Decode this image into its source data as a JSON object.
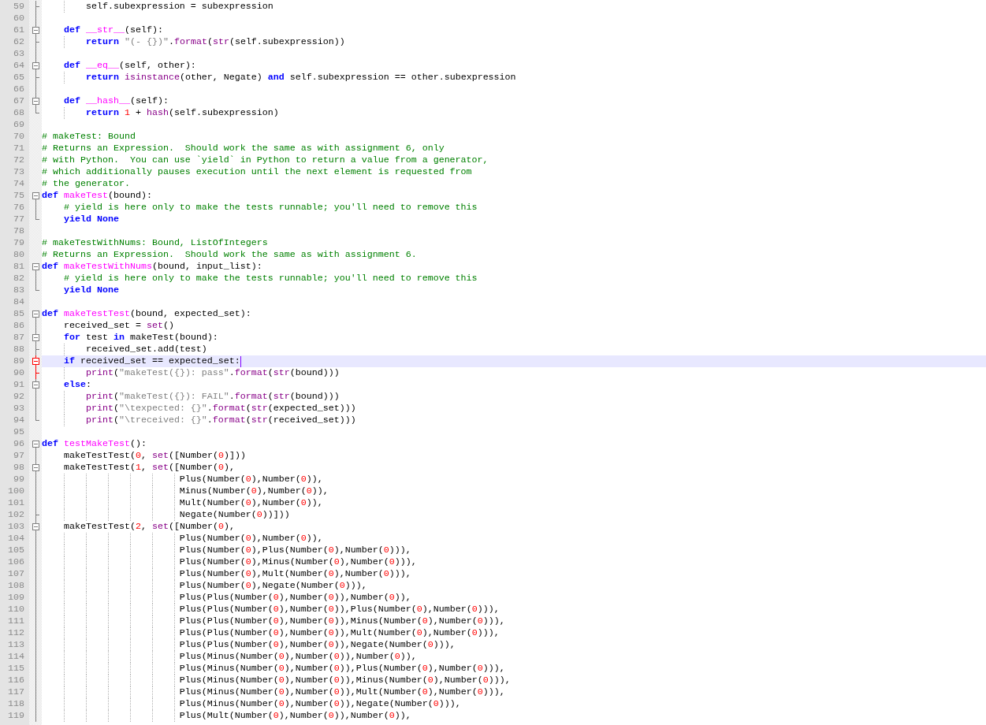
{
  "editor": {
    "lines": [
      {
        "number": "59",
        "current": false,
        "fold": {
          "kind": "tick",
          "active": false
        },
        "tokens": [
          {
            "kind": "txt",
            "text": "        self.subexpression = subexpression"
          }
        ]
      },
      {
        "number": "60",
        "current": false,
        "fold": {
          "kind": "line",
          "active": false
        }
      },
      {
        "number": "61",
        "current": false,
        "fold": {
          "kind": "start",
          "active": false
        },
        "tokens": [
          {
            "kind": "kw",
            "text": "    def"
          },
          {
            "kind": "fn",
            "text": " __str__"
          },
          {
            "kind": "txt",
            "text": "(self):"
          }
        ]
      },
      {
        "number": "62",
        "current": false,
        "fold": {
          "kind": "tick",
          "active": false
        },
        "tokens": [
          {
            "kind": "kw",
            "text": "        return"
          },
          {
            "kind": "str",
            "text": " \"(- {})\""
          },
          {
            "kind": "txt",
            "text": "."
          },
          {
            "kind": "bi",
            "text": "format"
          },
          {
            "kind": "txt",
            "text": "("
          },
          {
            "kind": "bi",
            "text": "str"
          },
          {
            "kind": "txt",
            "text": "(self.subexpression))"
          }
        ]
      },
      {
        "number": "63",
        "current": false,
        "fold": {
          "kind": "line",
          "active": false
        }
      },
      {
        "number": "64",
        "current": false,
        "fold": {
          "kind": "start",
          "active": false
        },
        "tokens": [
          {
            "kind": "kw",
            "text": "    def"
          },
          {
            "kind": "fn",
            "text": " __eq__"
          },
          {
            "kind": "txt",
            "text": "(self, other):"
          }
        ]
      },
      {
        "number": "65",
        "current": false,
        "fold": {
          "kind": "tick",
          "active": false
        },
        "tokens": [
          {
            "kind": "kw",
            "text": "        return"
          },
          {
            "kind": "bi",
            "text": " isinstance"
          },
          {
            "kind": "txt",
            "text": "(other, Negate) "
          },
          {
            "kind": "kw",
            "text": "and"
          },
          {
            "kind": "txt",
            "text": " self.subexpression == other.subexpression"
          }
        ]
      },
      {
        "number": "66",
        "current": false,
        "fold": {
          "kind": "line",
          "active": false
        }
      },
      {
        "number": "67",
        "current": false,
        "fold": {
          "kind": "start",
          "active": false
        },
        "tokens": [
          {
            "kind": "kw",
            "text": "    def"
          },
          {
            "kind": "fn",
            "text": " __hash__"
          },
          {
            "kind": "txt",
            "text": "(self):"
          }
        ]
      },
      {
        "number": "68",
        "current": false,
        "fold": {
          "kind": "end",
          "active": false
        },
        "tokens": [
          {
            "kind": "kw",
            "text": "        return"
          },
          {
            "kind": "txt",
            "text": " 1 + "
          },
          {
            "kind": "bi",
            "text": "hash"
          },
          {
            "kind": "txt",
            "text": "(self.subexpression)"
          }
        ]
      },
      {
        "number": "69",
        "current": false
      },
      {
        "number": "70",
        "current": false,
        "tokens": [
          {
            "kind": "com",
            "text": "# makeTest: Bound"
          }
        ]
      },
      {
        "number": "71",
        "current": false,
        "tokens": [
          {
            "kind": "com",
            "text": "# Returns an Expression.  Should work the same as with assignment 6, only"
          }
        ]
      },
      {
        "number": "72",
        "current": false,
        "tokens": [
          {
            "kind": "com",
            "text": "# with Python.  You can use `yield` in Python to return a value from a generator,"
          }
        ]
      },
      {
        "number": "73",
        "current": false,
        "tokens": [
          {
            "kind": "com",
            "text": "# which additionally pauses execution until the next element is requested from"
          }
        ]
      },
      {
        "number": "74",
        "current": false,
        "tokens": [
          {
            "kind": "com",
            "text": "# the generator."
          }
        ]
      },
      {
        "number": "75",
        "current": false,
        "fold": {
          "kind": "start",
          "active": false
        },
        "tokens": [
          {
            "kind": "kw",
            "text": "def"
          },
          {
            "kind": "fn",
            "text": " makeTest"
          },
          {
            "kind": "txt",
            "text": "(bound):"
          }
        ]
      },
      {
        "number": "76",
        "current": false,
        "fold": {
          "kind": "line",
          "active": false
        },
        "tokens": [
          {
            "kind": "com",
            "text": "    # yield is here only to make the tests runnable; you'll need to remove this"
          }
        ]
      },
      {
        "number": "77",
        "current": false,
        "fold": {
          "kind": "end",
          "active": false
        },
        "tokens": [
          {
            "kind": "kw",
            "text": "    yield None"
          }
        ]
      },
      {
        "number": "78",
        "current": false
      },
      {
        "number": "79",
        "current": false,
        "tokens": [
          {
            "kind": "com",
            "text": "# makeTestWithNums: Bound, ListOfIntegers"
          }
        ]
      },
      {
        "number": "80",
        "current": false,
        "tokens": [
          {
            "kind": "com",
            "text": "# Returns an Expression.  Should work the same as with assignment 6."
          }
        ]
      },
      {
        "number": "81",
        "current": false,
        "fold": {
          "kind": "start",
          "active": false
        },
        "tokens": [
          {
            "kind": "kw",
            "text": "def"
          },
          {
            "kind": "fn",
            "text": " makeTestWithNums"
          },
          {
            "kind": "txt",
            "text": "(bound, input_list):"
          }
        ]
      },
      {
        "number": "82",
        "current": false,
        "fold": {
          "kind": "line",
          "active": false
        },
        "tokens": [
          {
            "kind": "com",
            "text": "    # yield is here only to make the tests runnable; you'll need to remove this"
          }
        ]
      },
      {
        "number": "83",
        "current": false,
        "fold": {
          "kind": "end",
          "active": false
        },
        "tokens": [
          {
            "kind": "kw",
            "text": "    yield None"
          }
        ]
      },
      {
        "number": "84",
        "current": false
      },
      {
        "number": "85",
        "current": false,
        "fold": {
          "kind": "start",
          "active": false
        },
        "tokens": [
          {
            "kind": "kw",
            "text": "def"
          },
          {
            "kind": "fn",
            "text": " makeTestTest"
          },
          {
            "kind": "txt",
            "text": "(bound, expected_set):"
          }
        ]
      },
      {
        "number": "86",
        "current": false,
        "fold": {
          "kind": "line",
          "active": false
        },
        "tokens": [
          {
            "kind": "txt",
            "text": "    received_set = "
          },
          {
            "kind": "bi",
            "text": "set"
          },
          {
            "kind": "txt",
            "text": "()"
          }
        ]
      },
      {
        "number": "87",
        "current": false,
        "fold": {
          "kind": "start",
          "active": false
        },
        "tokens": [
          {
            "kind": "kw",
            "text": "    for"
          },
          {
            "kind": "txt",
            "text": " test "
          },
          {
            "kind": "kw",
            "text": "in"
          },
          {
            "kind": "txt",
            "text": " makeTest(bound):"
          }
        ]
      },
      {
        "number": "88",
        "current": false,
        "fold": {
          "kind": "tick",
          "active": false
        },
        "tokens": [
          {
            "kind": "txt",
            "text": "        received_set.add(test)"
          }
        ]
      },
      {
        "number": "89",
        "current": true,
        "fold": {
          "kind": "start",
          "active": true
        },
        "tokens": [
          {
            "kind": "kw",
            "text": "    if"
          },
          {
            "kind": "txt",
            "text": " received_set == expected_set:"
          }
        ]
      },
      {
        "number": "90",
        "current": false,
        "fold": {
          "kind": "tick",
          "active": true
        },
        "tokens": [
          {
            "kind": "bi",
            "text": "        print"
          },
          {
            "kind": "txt",
            "text": "("
          },
          {
            "kind": "str",
            "text": "\"makeTest({}): pass\""
          },
          {
            "kind": "txt",
            "text": "."
          },
          {
            "kind": "bi",
            "text": "format"
          },
          {
            "kind": "txt",
            "text": "("
          },
          {
            "kind": "bi",
            "text": "str"
          },
          {
            "kind": "txt",
            "text": "(bound)))"
          }
        ]
      },
      {
        "number": "91",
        "current": false,
        "fold": {
          "kind": "start",
          "active": false
        },
        "tokens": [
          {
            "kind": "kw",
            "text": "    else"
          },
          {
            "kind": "txt",
            "text": ":"
          }
        ]
      },
      {
        "number": "92",
        "current": false,
        "fold": {
          "kind": "line",
          "active": false
        },
        "tokens": [
          {
            "kind": "bi",
            "text": "        print"
          },
          {
            "kind": "txt",
            "text": "("
          },
          {
            "kind": "str",
            "text": "\"makeTest({}): FAIL\""
          },
          {
            "kind": "txt",
            "text": "."
          },
          {
            "kind": "bi",
            "text": "format"
          },
          {
            "kind": "txt",
            "text": "("
          },
          {
            "kind": "bi",
            "text": "str"
          },
          {
            "kind": "txt",
            "text": "(bound)))"
          }
        ]
      },
      {
        "number": "93",
        "current": false,
        "fold": {
          "kind": "line",
          "active": false
        },
        "tokens": [
          {
            "kind": "bi",
            "text": "        print"
          },
          {
            "kind": "txt",
            "text": "("
          },
          {
            "kind": "str",
            "text": "\"\\texpected: {}\""
          },
          {
            "kind": "txt",
            "text": "."
          },
          {
            "kind": "bi",
            "text": "format"
          },
          {
            "kind": "txt",
            "text": "("
          },
          {
            "kind": "bi",
            "text": "str"
          },
          {
            "kind": "txt",
            "text": "(expected_set)))"
          }
        ]
      },
      {
        "number": "94",
        "current": false,
        "fold": {
          "kind": "end",
          "active": false
        },
        "tokens": [
          {
            "kind": "bi",
            "text": "        print"
          },
          {
            "kind": "txt",
            "text": "("
          },
          {
            "kind": "str",
            "text": "\"\\treceived: {}\""
          },
          {
            "kind": "txt",
            "text": "."
          },
          {
            "kind": "bi",
            "text": "format"
          },
          {
            "kind": "txt",
            "text": "("
          },
          {
            "kind": "bi",
            "text": "str"
          },
          {
            "kind": "txt",
            "text": "(received_set)))"
          }
        ]
      },
      {
        "number": "95",
        "current": false
      },
      {
        "number": "96",
        "current": false,
        "fold": {
          "kind": "start",
          "active": false
        },
        "tokens": [
          {
            "kind": "kw",
            "text": "def"
          },
          {
            "kind": "fn",
            "text": " testMakeTest"
          },
          {
            "kind": "txt",
            "text": "():"
          }
        ]
      },
      {
        "number": "97",
        "current": false,
        "fold": {
          "kind": "line",
          "active": false
        },
        "tokens": [
          {
            "kind": "txt",
            "text": "    makeTestTest(0, "
          },
          {
            "kind": "bi",
            "text": "set"
          },
          {
            "kind": "txt",
            "text": "([Number(0)]))"
          }
        ]
      },
      {
        "number": "98",
        "current": false,
        "fold": {
          "kind": "start",
          "active": false
        },
        "tokens": [
          {
            "kind": "txt",
            "text": "    makeTestTest(1, "
          },
          {
            "kind": "bi",
            "text": "set"
          },
          {
            "kind": "txt",
            "text": "([Number(0),"
          }
        ]
      },
      {
        "number": "99",
        "current": false,
        "fold": {
          "kind": "line",
          "active": false
        },
        "tokens": [
          {
            "kind": "txt",
            "text": "                         Plus(Number(0),Number(0)),"
          }
        ]
      },
      {
        "number": "100",
        "current": false,
        "fold": {
          "kind": "line",
          "active": false
        },
        "tokens": [
          {
            "kind": "txt",
            "text": "                         Minus(Number(0),Number(0)),"
          }
        ]
      },
      {
        "number": "101",
        "current": false,
        "fold": {
          "kind": "line",
          "active": false
        },
        "tokens": [
          {
            "kind": "txt",
            "text": "                         Mult(Number(0),Number(0)),"
          }
        ]
      },
      {
        "number": "102",
        "current": false,
        "fold": {
          "kind": "tick",
          "active": false
        },
        "tokens": [
          {
            "kind": "txt",
            "text": "                         Negate(Number(0))]))"
          }
        ]
      },
      {
        "number": "103",
        "current": false,
        "fold": {
          "kind": "start",
          "active": false
        },
        "tokens": [
          {
            "kind": "txt",
            "text": "    makeTestTest(2, "
          },
          {
            "kind": "bi",
            "text": "set"
          },
          {
            "kind": "txt",
            "text": "([Number(0),"
          }
        ]
      },
      {
        "number": "104",
        "current": false,
        "fold": {
          "kind": "line",
          "active": false
        },
        "tokens": [
          {
            "kind": "txt",
            "text": "                         Plus(Number(0),Number(0)),"
          }
        ]
      },
      {
        "number": "105",
        "current": false,
        "fold": {
          "kind": "line",
          "active": false
        },
        "tokens": [
          {
            "kind": "txt",
            "text": "                         Plus(Number(0),Plus(Number(0),Number(0))),"
          }
        ]
      },
      {
        "number": "106",
        "current": false,
        "fold": {
          "kind": "line",
          "active": false
        },
        "tokens": [
          {
            "kind": "txt",
            "text": "                         Plus(Number(0),Minus(Number(0),Number(0))),"
          }
        ]
      },
      {
        "number": "107",
        "current": false,
        "fold": {
          "kind": "line",
          "active": false
        },
        "tokens": [
          {
            "kind": "txt",
            "text": "                         Plus(Number(0),Mult(Number(0),Number(0))),"
          }
        ]
      },
      {
        "number": "108",
        "current": false,
        "fold": {
          "kind": "line",
          "active": false
        },
        "tokens": [
          {
            "kind": "txt",
            "text": "                         Plus(Number(0),Negate(Number(0))),"
          }
        ]
      },
      {
        "number": "109",
        "current": false,
        "fold": {
          "kind": "line",
          "active": false
        },
        "tokens": [
          {
            "kind": "txt",
            "text": "                         Plus(Plus(Number(0),Number(0)),Number(0)),"
          }
        ]
      },
      {
        "number": "110",
        "current": false,
        "fold": {
          "kind": "line",
          "active": false
        },
        "tokens": [
          {
            "kind": "txt",
            "text": "                         Plus(Plus(Number(0),Number(0)),Plus(Number(0),Number(0))),"
          }
        ]
      },
      {
        "number": "111",
        "current": false,
        "fold": {
          "kind": "line",
          "active": false
        },
        "tokens": [
          {
            "kind": "txt",
            "text": "                         Plus(Plus(Number(0),Number(0)),Minus(Number(0),Number(0))),"
          }
        ]
      },
      {
        "number": "112",
        "current": false,
        "fold": {
          "kind": "line",
          "active": false
        },
        "tokens": [
          {
            "kind": "txt",
            "text": "                         Plus(Plus(Number(0),Number(0)),Mult(Number(0),Number(0))),"
          }
        ]
      },
      {
        "number": "113",
        "current": false,
        "fold": {
          "kind": "line",
          "active": false
        },
        "tokens": [
          {
            "kind": "txt",
            "text": "                         Plus(Plus(Number(0),Number(0)),Negate(Number(0))),"
          }
        ]
      },
      {
        "number": "114",
        "current": false,
        "fold": {
          "kind": "line",
          "active": false
        },
        "tokens": [
          {
            "kind": "txt",
            "text": "                         Plus(Minus(Number(0),Number(0)),Number(0)),"
          }
        ]
      },
      {
        "number": "115",
        "current": false,
        "fold": {
          "kind": "line",
          "active": false
        },
        "tokens": [
          {
            "kind": "txt",
            "text": "                         Plus(Minus(Number(0),Number(0)),Plus(Number(0),Number(0))),"
          }
        ]
      },
      {
        "number": "116",
        "current": false,
        "fold": {
          "kind": "line",
          "active": false
        },
        "tokens": [
          {
            "kind": "txt",
            "text": "                         Plus(Minus(Number(0),Number(0)),Minus(Number(0),Number(0))),"
          }
        ]
      },
      {
        "number": "117",
        "current": false,
        "fold": {
          "kind": "line",
          "active": false
        },
        "tokens": [
          {
            "kind": "txt",
            "text": "                         Plus(Minus(Number(0),Number(0)),Mult(Number(0),Number(0))),"
          }
        ]
      },
      {
        "number": "118",
        "current": false,
        "fold": {
          "kind": "line",
          "active": false
        },
        "tokens": [
          {
            "kind": "txt",
            "text": "                         Plus(Minus(Number(0),Number(0)),Negate(Number(0))),"
          }
        ]
      },
      {
        "number": "119",
        "current": false,
        "fold": {
          "kind": "line",
          "active": false
        },
        "tokens": [
          {
            "kind": "txt",
            "text": "                         Plus(Mult(Number(0),Number(0)),Number(0)),"
          }
        ]
      }
    ]
  }
}
